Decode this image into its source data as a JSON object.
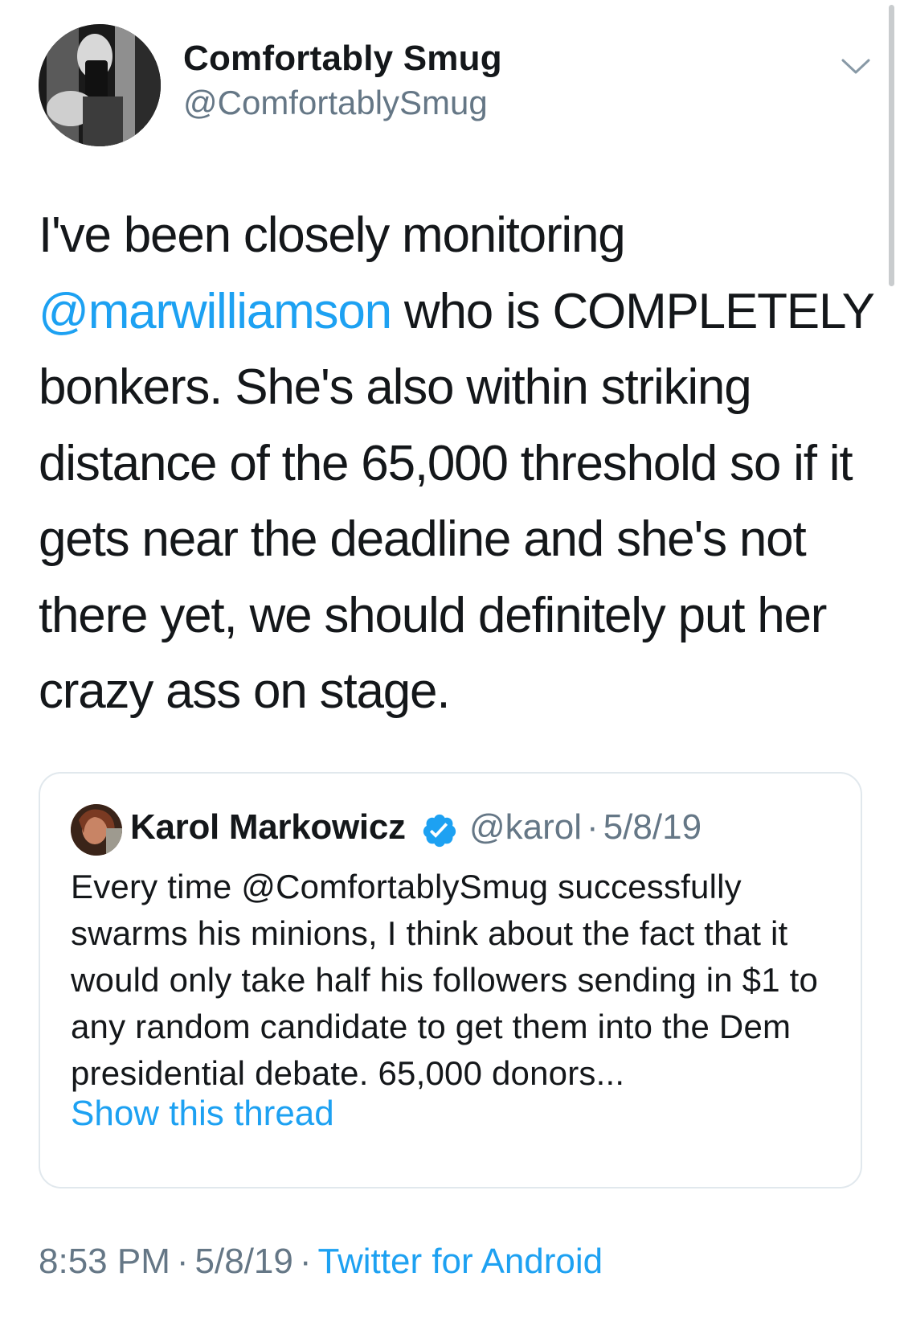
{
  "tweet": {
    "author_name": "Comfortably Smug",
    "author_handle": "@ComfortablySmug",
    "text_before_mention": "I've been closely monitoring ",
    "mention": "@marwilliamson",
    "text_after_mention": " who is COMPLETELY bonkers. She's also within striking distance of the 65,000 threshold so if it gets near the deadline and she's not there yet, we should definitely put her crazy ass on stage.",
    "time": "8:53 PM",
    "separator": "·",
    "date": "5/8/19",
    "source": "Twitter for Android",
    "menu_icon": "chevron-down-icon"
  },
  "quoted_tweet": {
    "author_name": "Karol Markowicz",
    "verified": true,
    "verified_icon": "verified-badge-icon",
    "author_handle": "@karol",
    "separator": "·",
    "date": "5/8/19",
    "text": "Every time @ComfortablySmug successfully swarms his minions, I think about the fact that it would only take half his followers sending in $1 to any random candidate to get them into the Dem presidential debate. 65,000 donors...",
    "show_thread_label": "Show this thread"
  },
  "colors": {
    "accent": "#1da1f2",
    "secondary_text": "#657786",
    "primary_text": "#14171a",
    "border": "#e1e8ed"
  }
}
